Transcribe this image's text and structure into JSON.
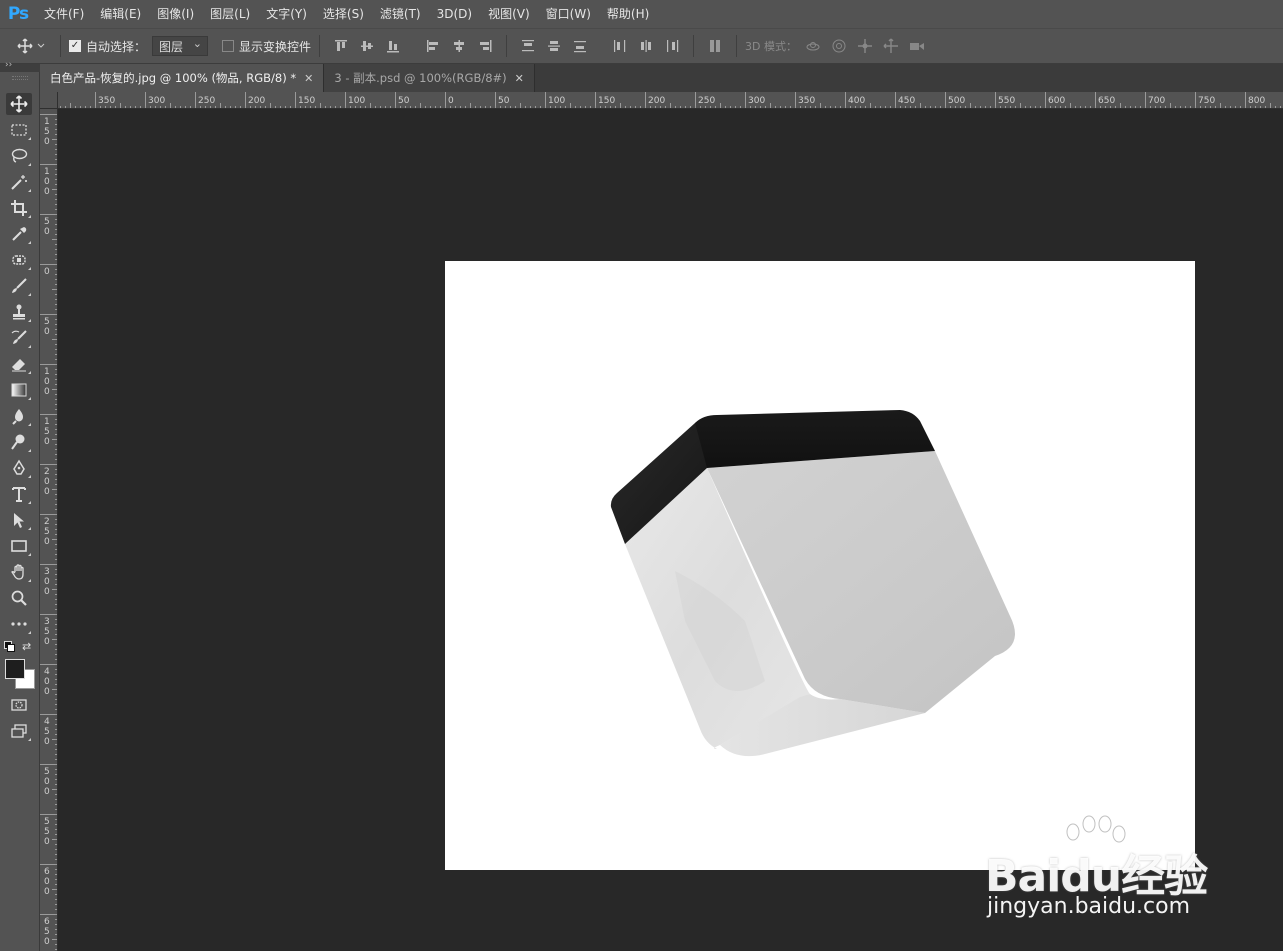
{
  "app": {
    "logo": "Ps",
    "accent": "#31a8ff"
  },
  "menu": [
    "文件(F)",
    "编辑(E)",
    "图像(I)",
    "图层(L)",
    "文字(Y)",
    "选择(S)",
    "滤镜(T)",
    "3D(D)",
    "视图(V)",
    "窗口(W)",
    "帮助(H)"
  ],
  "options": {
    "auto_select_label": "自动选择：",
    "auto_select_checked": true,
    "auto_select_target": "图层",
    "show_transform_label": "显示变换控件",
    "show_transform_checked": false,
    "mode_3d_label": "3D 模式："
  },
  "tabs": [
    {
      "label": "白色产品-恢复的.jpg @ 100% (物品, RGB/8) *",
      "active": true
    },
    {
      "label": "3 - 副本.psd @ 100%(RGB/8#)",
      "active": false
    }
  ],
  "ruler_top_labels": [
    "350",
    "300",
    "250",
    "200",
    "150",
    "100",
    "50",
    "0",
    "50",
    "100",
    "150",
    "200",
    "250",
    "300",
    "350",
    "400",
    "450",
    "500",
    "550",
    "600",
    "650",
    "700",
    "750",
    "800"
  ],
  "ruler_left_labels": [
    "150",
    "100",
    "50",
    "0",
    "50",
    "100",
    "150",
    "200",
    "250",
    "300",
    "350",
    "400",
    "450",
    "500",
    "550",
    "600",
    "650"
  ],
  "tools": [
    "move-tool",
    "marquee-tool",
    "lasso-tool",
    "magic-wand-tool",
    "crop-tool",
    "eyedropper-tool",
    "healing-brush-tool",
    "brush-tool",
    "clone-stamp-tool",
    "history-brush-tool",
    "eraser-tool",
    "gradient-tool",
    "blur-tool",
    "dodge-tool",
    "pen-tool",
    "type-tool",
    "path-selection-tool",
    "rectangle-tool",
    "hand-tool",
    "zoom-tool",
    "more-tools"
  ],
  "colors": {
    "foreground": "#1e1e1e",
    "background": "#ffffff"
  },
  "watermark": {
    "brand": "Baidu经验",
    "url": "jingyan.baidu.com"
  }
}
